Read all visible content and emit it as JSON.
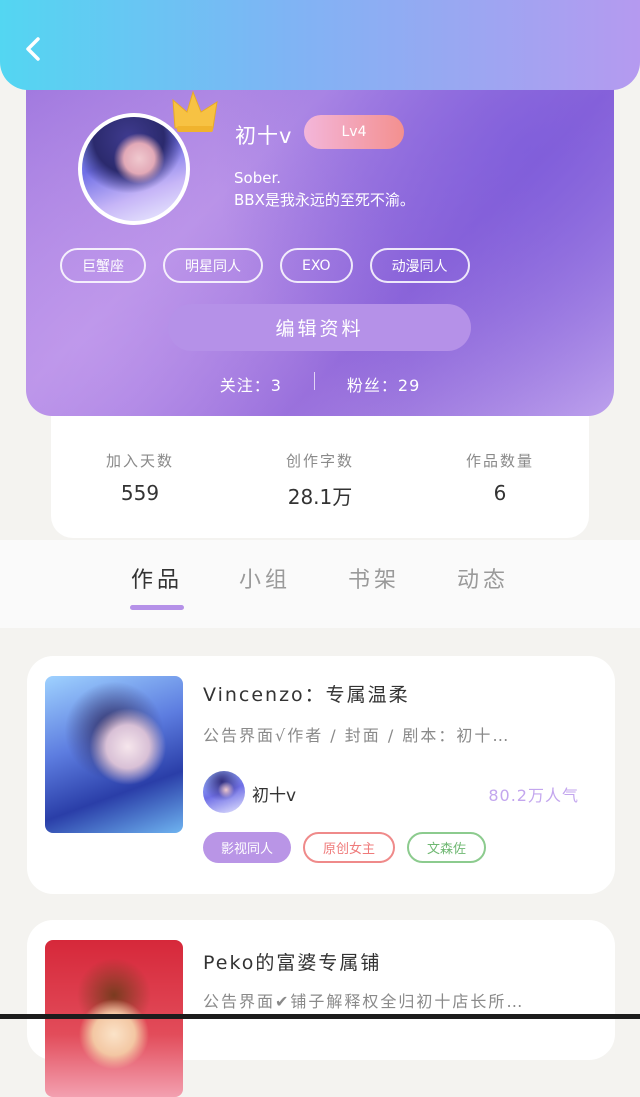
{
  "profile": {
    "nickname": "初十v",
    "level": "Lv4",
    "bio_line1": "Sober.",
    "bio_line2": "BBX是我永远的至死不渝。",
    "tags": [
      "巨蟹座",
      "明星同人",
      "EXO",
      "动漫同人"
    ],
    "edit_label": "编辑资料",
    "follow_text": "关注：3",
    "fans_text": "粉丝：29"
  },
  "stats": [
    {
      "label": "加入天数",
      "value": "559"
    },
    {
      "label": "创作字数",
      "value": "28.1万"
    },
    {
      "label": "作品数量",
      "value": "6"
    }
  ],
  "tabs": [
    "作品",
    "小组",
    "书架",
    "动态"
  ],
  "works": [
    {
      "title": "Vincenzo：专属温柔",
      "notice": "公告界面√作者 / 封面 / 剧本：初十…",
      "author": "初十v",
      "popularity": "80.2万人气",
      "tags": [
        "影视同人",
        "原创女主",
        "文森佐"
      ]
    },
    {
      "title": "Peko的富婆专属铺",
      "notice": "公告界面✔铺子解释权全归初十店长所…"
    }
  ],
  "colors": {
    "accent": "#b591e8",
    "topbar_start": "#53d6f2",
    "topbar_end": "#b59af0"
  }
}
